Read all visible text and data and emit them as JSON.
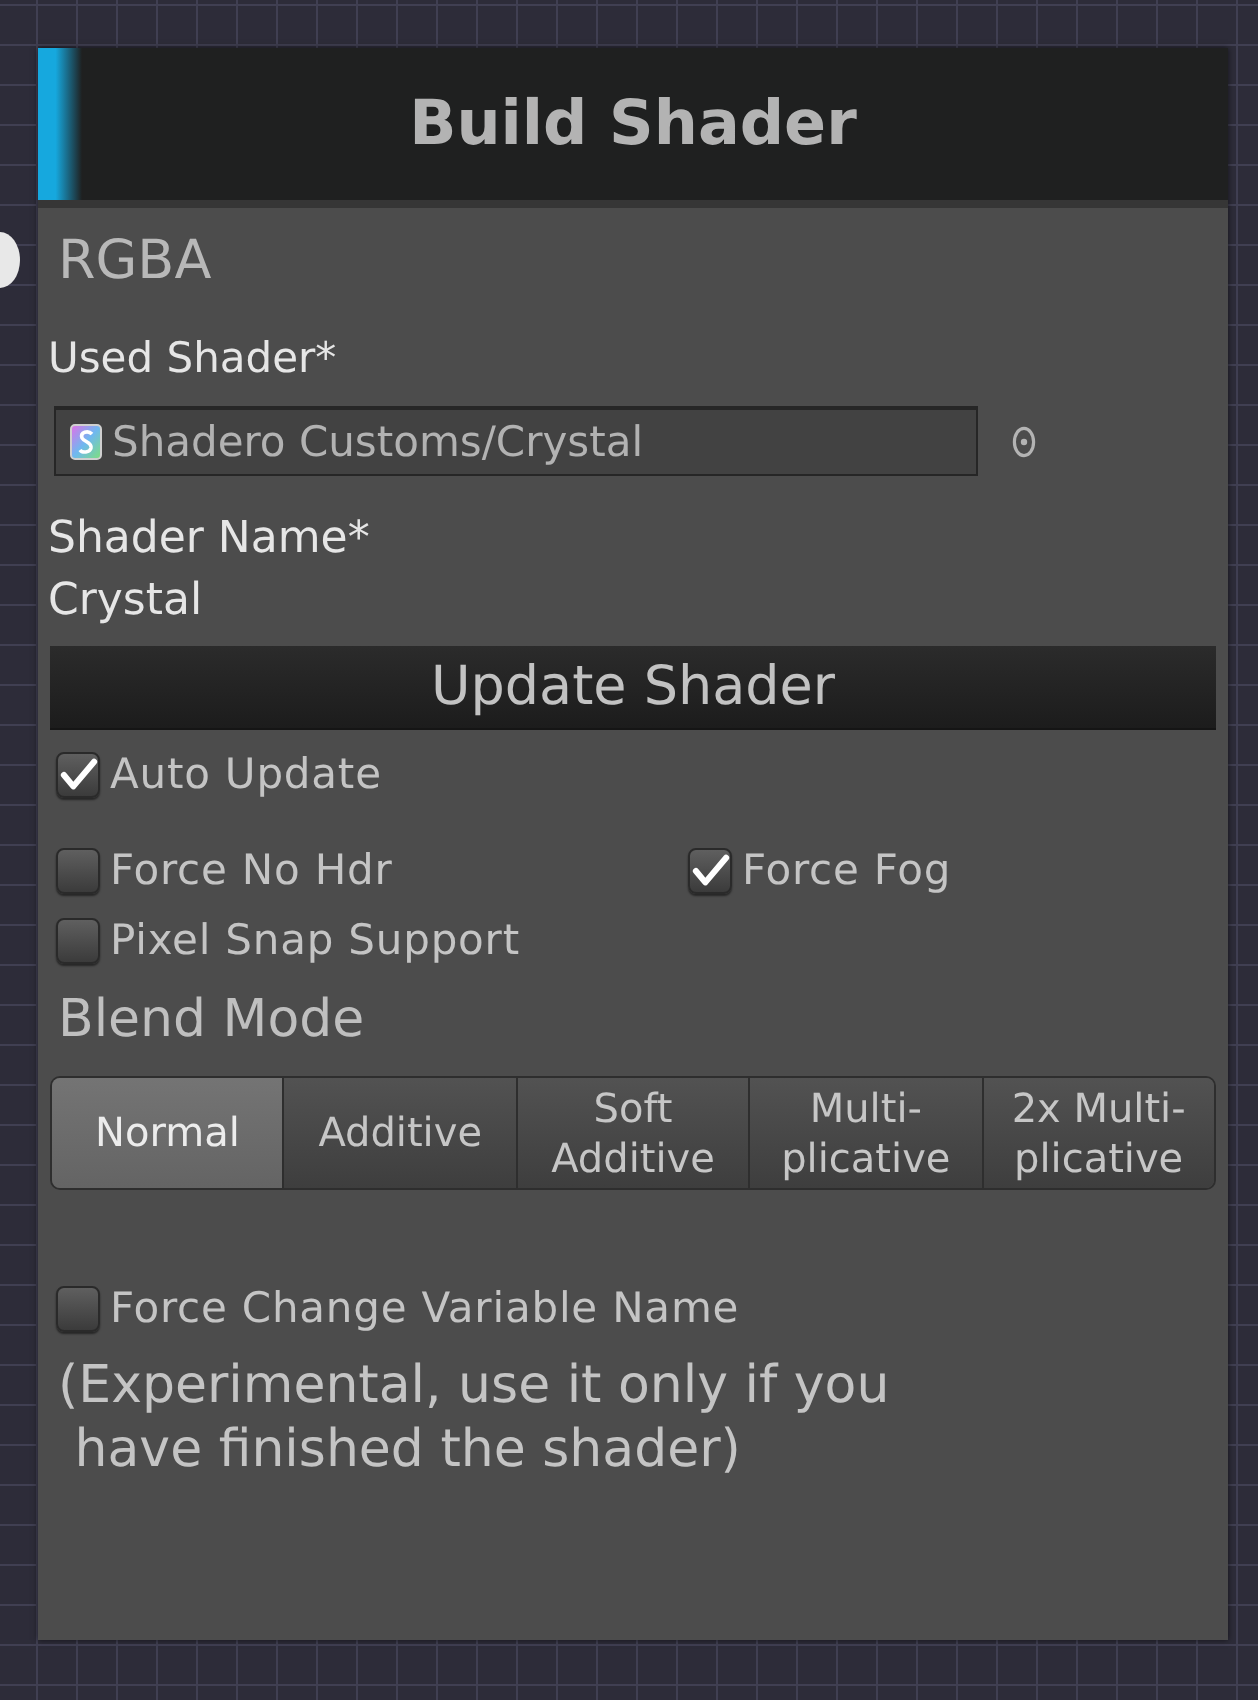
{
  "node": {
    "title": "Build Shader",
    "output_label": "RGBA"
  },
  "used_shader": {
    "label": "Used Shader*",
    "value": "Shadero Customs/Crystal"
  },
  "shader_name": {
    "label": "Shader Name*",
    "value": "Crystal"
  },
  "update_button": {
    "label": "Update Shader"
  },
  "option_rows": [
    [
      {
        "label": "Auto Update",
        "checked": true
      }
    ],
    [
      {
        "label": "Force No Hdr",
        "checked": false
      },
      {
        "label": "Force Fog",
        "checked": true
      }
    ],
    [
      {
        "label": "Pixel Snap Support",
        "checked": false
      }
    ]
  ],
  "blend_mode": {
    "label": "Blend Mode",
    "modes": [
      {
        "label": "Normal",
        "selected": true
      },
      {
        "label": "Additive",
        "selected": false
      },
      {
        "label": "Soft\nAdditive",
        "selected": false
      },
      {
        "label": "Multi-\nplicative",
        "selected": false
      },
      {
        "label": "2x Multi-\nplicative",
        "selected": false
      }
    ]
  },
  "force_change_variable_name": {
    "label": "Force Change Variable Name",
    "checked": false
  },
  "note": "(Experimental, use it only if you\n have finished the shader)"
}
